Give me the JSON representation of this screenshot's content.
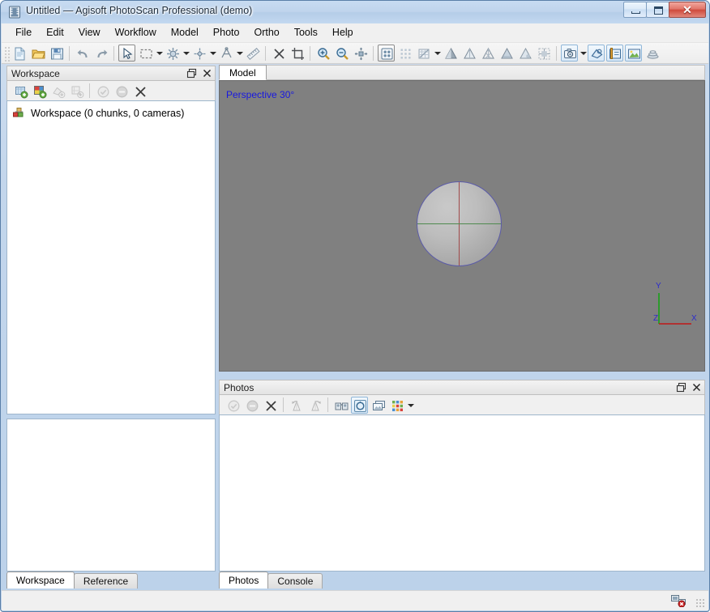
{
  "window": {
    "title": "Untitled — Agisoft PhotoScan Professional (demo)",
    "icon": "app-icon",
    "controls": {
      "minimize": "minimize-button",
      "maximize": "restore-button",
      "close_glyph": "✕"
    }
  },
  "menu": {
    "items": [
      {
        "label": "File"
      },
      {
        "label": "Edit"
      },
      {
        "label": "View"
      },
      {
        "label": "Workflow"
      },
      {
        "label": "Model"
      },
      {
        "label": "Photo"
      },
      {
        "label": "Ortho"
      },
      {
        "label": "Tools"
      },
      {
        "label": "Help"
      }
    ]
  },
  "toolbar": {
    "groups": [
      {
        "buttons": [
          {
            "icon": "new-document-icon",
            "state": "normal"
          },
          {
            "icon": "open-folder-icon",
            "state": "normal"
          },
          {
            "icon": "save-disk-icon",
            "state": "normal"
          }
        ]
      },
      {
        "buttons": [
          {
            "icon": "undo-arrow-icon",
            "state": "normal"
          },
          {
            "icon": "redo-arrow-icon",
            "state": "normal"
          }
        ]
      },
      {
        "buttons": [
          {
            "icon": "pointer-select-icon",
            "state": "selected"
          },
          {
            "icon": "rectangle-select-icon",
            "state": "normal",
            "dropdown": true
          },
          {
            "icon": "move-object-icon",
            "state": "normal",
            "dropdown": true
          },
          {
            "icon": "rotate-object-icon",
            "state": "normal",
            "dropdown": true
          },
          {
            "icon": "scale-object-icon",
            "state": "normal",
            "dropdown": true
          },
          {
            "icon": "ruler-measure-icon",
            "state": "normal"
          }
        ]
      },
      {
        "buttons": [
          {
            "icon": "delete-cross-icon",
            "state": "normal"
          },
          {
            "icon": "crop-selection-icon",
            "state": "normal"
          }
        ]
      },
      {
        "buttons": [
          {
            "icon": "zoom-in-icon",
            "state": "normal"
          },
          {
            "icon": "zoom-out-icon",
            "state": "normal"
          },
          {
            "icon": "reset-view-icon",
            "state": "normal"
          }
        ]
      },
      {
        "buttons": [
          {
            "icon": "point-cloud-icon",
            "state": "selected"
          },
          {
            "icon": "dense-cloud-icon",
            "state": "normal"
          },
          {
            "icon": "mesh-texture-icon",
            "state": "normal",
            "dropdown": true
          },
          {
            "icon": "shaded-model-icon",
            "state": "normal"
          },
          {
            "icon": "solid-model-icon",
            "state": "normal"
          },
          {
            "icon": "wireframe-model-icon",
            "state": "normal"
          },
          {
            "icon": "textured-model-icon",
            "state": "normal"
          },
          {
            "icon": "confidence-model-icon",
            "state": "normal"
          },
          {
            "icon": "tiled-model-icon",
            "state": "normal"
          }
        ]
      },
      {
        "buttons": [
          {
            "icon": "show-cameras-icon",
            "state": "active",
            "dropdown": true
          },
          {
            "icon": "show-markers-icon",
            "state": "active"
          },
          {
            "icon": "show-region-icon",
            "state": "active"
          },
          {
            "icon": "show-images-icon",
            "state": "active"
          },
          {
            "icon": "show-tiles-icon",
            "state": "normal"
          }
        ]
      }
    ]
  },
  "workspace_panel": {
    "title": "Workspace",
    "float_button": "undock-icon",
    "close_button": "close-panel-icon",
    "toolbar_buttons": [
      {
        "icon": "add-chunk-icon",
        "enabled": true
      },
      {
        "icon": "add-photos-icon",
        "enabled": true
      },
      {
        "icon": "add-markers-icon",
        "enabled": false
      },
      {
        "icon": "add-scalebar-icon",
        "enabled": false
      },
      {
        "icon": "enable-item-icon",
        "enabled": false
      },
      {
        "icon": "disable-item-icon",
        "enabled": false
      },
      {
        "icon": "remove-item-icon",
        "enabled": true
      }
    ],
    "tree": [
      {
        "icon": "workspace-node-icon",
        "label": "Workspace (0 chunks, 0 cameras)"
      }
    ]
  },
  "left_bottom_tabs": {
    "tabs": [
      {
        "label": "Workspace",
        "active": true
      },
      {
        "label": "Reference",
        "active": false
      }
    ]
  },
  "model_view": {
    "tabs": [
      {
        "label": "Model",
        "active": true
      }
    ],
    "overlay_label": "Perspective 30°",
    "overlay_color": "#1818e0",
    "background_color": "#808080",
    "sphere": {
      "name": "region-sphere",
      "outline_color": "#5b5ba8",
      "vertical_axis_color": "#a04a4a",
      "horizontal_axis_color": "#4f8a4f"
    },
    "axis_gizmo": {
      "labels": [
        {
          "text": "Y",
          "axis": "y"
        },
        {
          "text": "Z",
          "axis": "z"
        },
        {
          "text": "X",
          "axis": "x"
        }
      ],
      "y_axis_color": "#18a018",
      "x_axis_color": "#c01818",
      "label_color": "#2b2bcd"
    }
  },
  "photos_panel": {
    "title": "Photos",
    "float_button": "undock-icon",
    "close_button": "close-panel-icon",
    "toolbar_buttons": [
      {
        "icon": "enable-photo-icon",
        "enabled": false
      },
      {
        "icon": "disable-photo-icon",
        "enabled": false
      },
      {
        "icon": "remove-photo-icon",
        "enabled": true
      },
      {
        "icon": "rotate-left-icon",
        "enabled": false
      },
      {
        "icon": "rotate-right-icon",
        "enabled": false
      },
      {
        "icon": "match-photos-icon",
        "enabled": true
      },
      {
        "icon": "reset-photo-icon",
        "enabled": true,
        "state": "active"
      },
      {
        "icon": "detail-view-icon",
        "enabled": true
      },
      {
        "icon": "thumbnail-grid-icon",
        "enabled": true,
        "dropdown": true
      }
    ]
  },
  "bottom_right_tabs": {
    "tabs": [
      {
        "label": "Photos",
        "active": true
      },
      {
        "label": "Console",
        "active": false
      }
    ]
  },
  "statusbar": {
    "message": "",
    "network_icon": "network-disconnected-icon",
    "resize_grip": "resize-grip"
  }
}
